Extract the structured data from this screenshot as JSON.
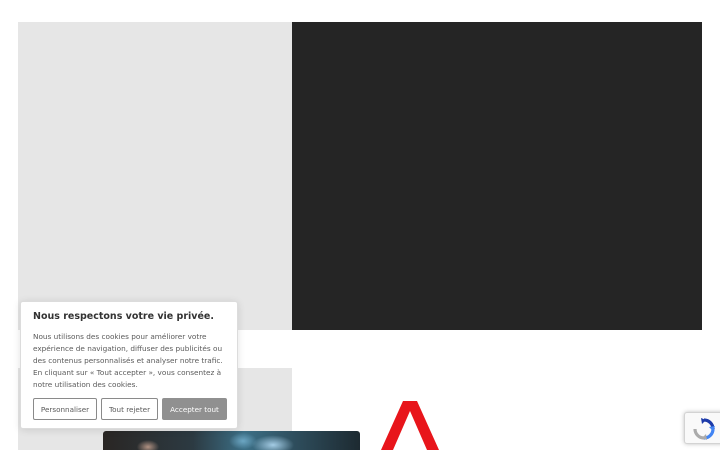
{
  "cookie_banner": {
    "title": "Nous respectons votre vie privée.",
    "message": "Nous utilisons des cookies pour améliorer votre expérience de navigation, diffuser des publicités ou des contenus personnalisés et analyser notre trafic. En cliquant sur « Tout accepter », vous consentez à notre utilisation des cookies.",
    "customize_label": "Personnaliser",
    "reject_label": "Tout rejeter",
    "accept_label": "Accepter tout"
  },
  "colors": {
    "hero_dark": "#252525",
    "placeholder_gray": "#e6e6e6",
    "brand_red": "#e8151b",
    "accept_button": "#909090"
  },
  "icons": {
    "brand": "red-a-logo-icon",
    "recaptcha": "recaptcha-icon"
  }
}
